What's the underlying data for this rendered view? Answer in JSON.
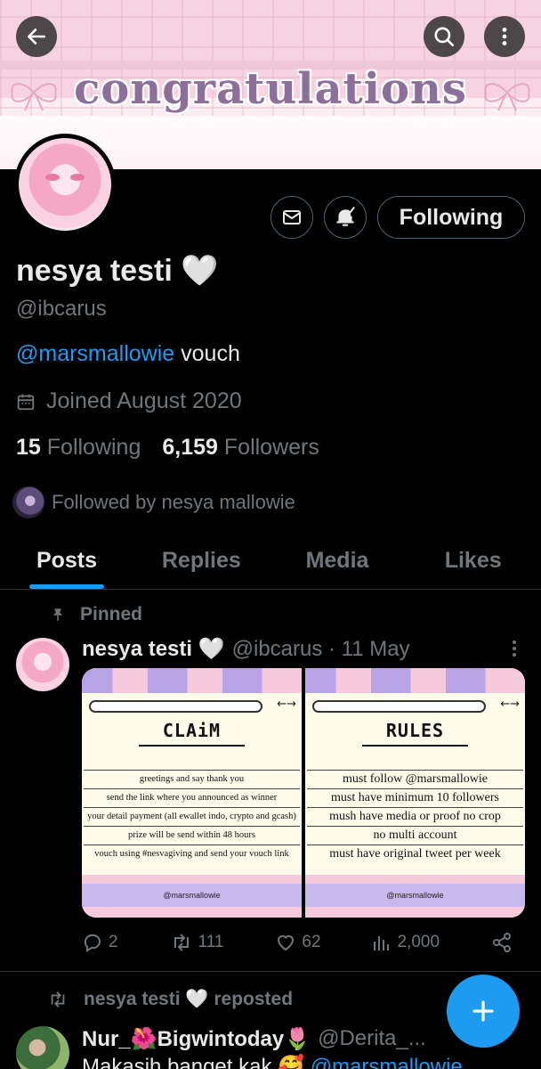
{
  "banner": {
    "title": "congratulations"
  },
  "profile": {
    "name": "nesya testi 🤍",
    "handle": "@ibcarus",
    "bio_mention": "@marsmallowie",
    "bio_text": " vouch",
    "joined": "Joined August 2020",
    "following_count": "15",
    "following_label": "Following",
    "followers_count": "6,159",
    "followers_label": "Followers",
    "followed_by": "Followed by nesya mallowie",
    "follow_button": "Following"
  },
  "tabs": [
    "Posts",
    "Replies",
    "Media",
    "Likes"
  ],
  "pinned_post": {
    "pinned_label": "Pinned",
    "name": "nesya testi 🤍",
    "meta": "@ibcarus · 11 May",
    "left_card": {
      "heading": "CLAiM",
      "arrows": "←→",
      "rows": [
        "greetings and say thank you",
        "send the link where you announced as winner",
        "your detail payment (all ewallet indo, crypto and gcash)",
        "prize will be send within 48 hours",
        "vouch using #nesvagiving and send your vouch link"
      ],
      "footer": "@marsmallowie"
    },
    "right_card": {
      "heading": "RULES",
      "arrows": "←→",
      "rows": [
        "must follow @marsmallowie",
        "must have minimum 10 followers",
        "mush have media or proof no crop",
        "no multi account",
        "must have original tweet per week"
      ],
      "footer": "@marsmallowie"
    },
    "replies": "2",
    "reposts": "111",
    "likes": "62",
    "views": "2,000"
  },
  "repost": {
    "label": "nesya testi 🤍 reposted",
    "name": "Nur_🌺Bigwintoday🌷",
    "meta": "@Derita_...",
    "text": "Makasih banget kak 🥰 ",
    "mention": "@marsmallowie"
  },
  "colors": {
    "accent": "#1d9bf0",
    "muted": "#71767b",
    "background": "#000000"
  }
}
